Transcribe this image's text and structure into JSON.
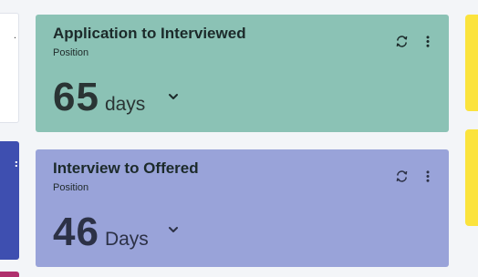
{
  "cards": [
    {
      "title": "Application to Interviewed",
      "subtitle": "Position",
      "value": "65",
      "unit": "days",
      "color": "#8bc2b5",
      "icons": [
        "refresh-icon",
        "more-vertical-icon",
        "chevron-down-icon"
      ]
    },
    {
      "title": "Interview to Offered",
      "subtitle": "Position",
      "value": "46",
      "unit": "Days",
      "color": "#99a3d9",
      "icons": [
        "refresh-icon",
        "more-vertical-icon",
        "chevron-down-icon"
      ]
    }
  ],
  "side_colors": {
    "left_top": "#ffffff",
    "left_middle": "#3e4fb0",
    "left_bottom": "#b0306d",
    "right": "#fbe33d"
  }
}
